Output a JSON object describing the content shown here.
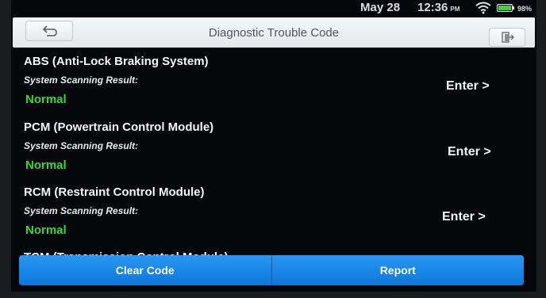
{
  "status_bar": {
    "date": "May 28",
    "time": "12:36",
    "ampm": "PM",
    "battery": "98%",
    "battery_level": 0.98
  },
  "header": {
    "title": "Diagnostic Trouble Code",
    "back_icon": "back-arrow-icon",
    "exit_icon": "exit-icon"
  },
  "systems": [
    {
      "name": "ABS (Anti-Lock Braking System)",
      "subtitle": "System Scanning Result:",
      "status": "Normal",
      "action": "Enter >"
    },
    {
      "name": "PCM (Powertrain Control Module)",
      "subtitle": "System Scanning Result:",
      "status": "Normal",
      "action": "Enter >"
    },
    {
      "name": "RCM (Restraint Control Module)",
      "subtitle": "System Scanning Result:",
      "status": "Normal",
      "action": "Enter >"
    },
    {
      "name": "TCM (Transmission Control Module)"
    }
  ],
  "footer": {
    "clear_label": "Clear Code",
    "report_label": "Report"
  },
  "colors": {
    "status_normal": "#35d835",
    "button_blue": "#1789e6",
    "background": "#06070a"
  }
}
